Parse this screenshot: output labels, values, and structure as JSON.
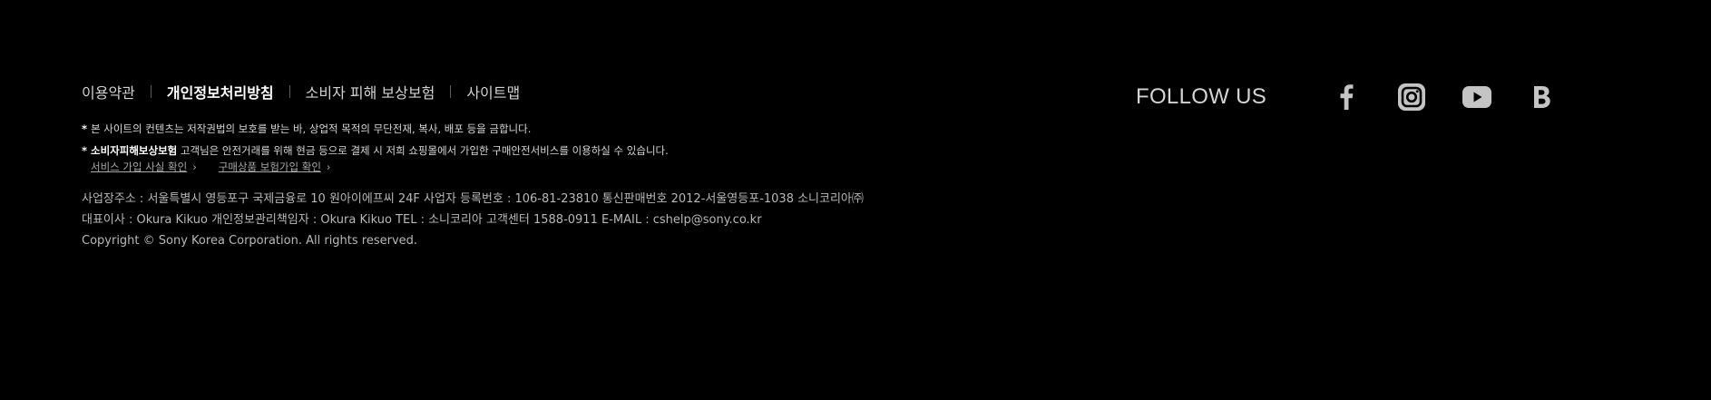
{
  "nav": {
    "items": [
      {
        "label": "이용약관"
      },
      {
        "label": "개인정보처리방침"
      },
      {
        "label": "소비자 피해 보상보험"
      },
      {
        "label": "사이트맵"
      }
    ]
  },
  "notices": {
    "star": "*",
    "line1": "본 사이트의 컨텐츠는 저작권법의 보호를 받는 바, 상업적 목적의 무단전재, 복사, 배포 등을 금합니다.",
    "line2_bold": "소비자피해보상보험",
    "line2_rest": " 고객님은 안전거래를 위해 현금 등으로 결제 시 저희 쇼핑몰에서 가입한 구매안전서비스를 이용하실 수 있습니다.",
    "link1": "서비스 가입 사실 확인",
    "link2": "구매상품 보험가입 확인",
    "chevron": "›"
  },
  "company": {
    "line1": "사업장주소 : 서울특별시 영등포구 국제금융로 10 원아이에프씨 24F 사업자 등록번호 : 106-81-23810 통신판매번호 2012-서울영등포-1038 소니코리아㈜",
    "line2": "대표이사 : Okura Kikuo 개인정보관리책임자 : Okura Kikuo TEL : 소니코리아 고객센터 1588-0911 E-MAIL : cshelp@sony.co.kr",
    "line3": "Copyright © Sony Korea Corporation. All rights reserved."
  },
  "follow": {
    "title": "FOLLOW US",
    "icons": [
      "facebook-icon",
      "instagram-icon",
      "youtube-icon",
      "blog-icon"
    ],
    "icon_color": "#c4c4c4"
  }
}
